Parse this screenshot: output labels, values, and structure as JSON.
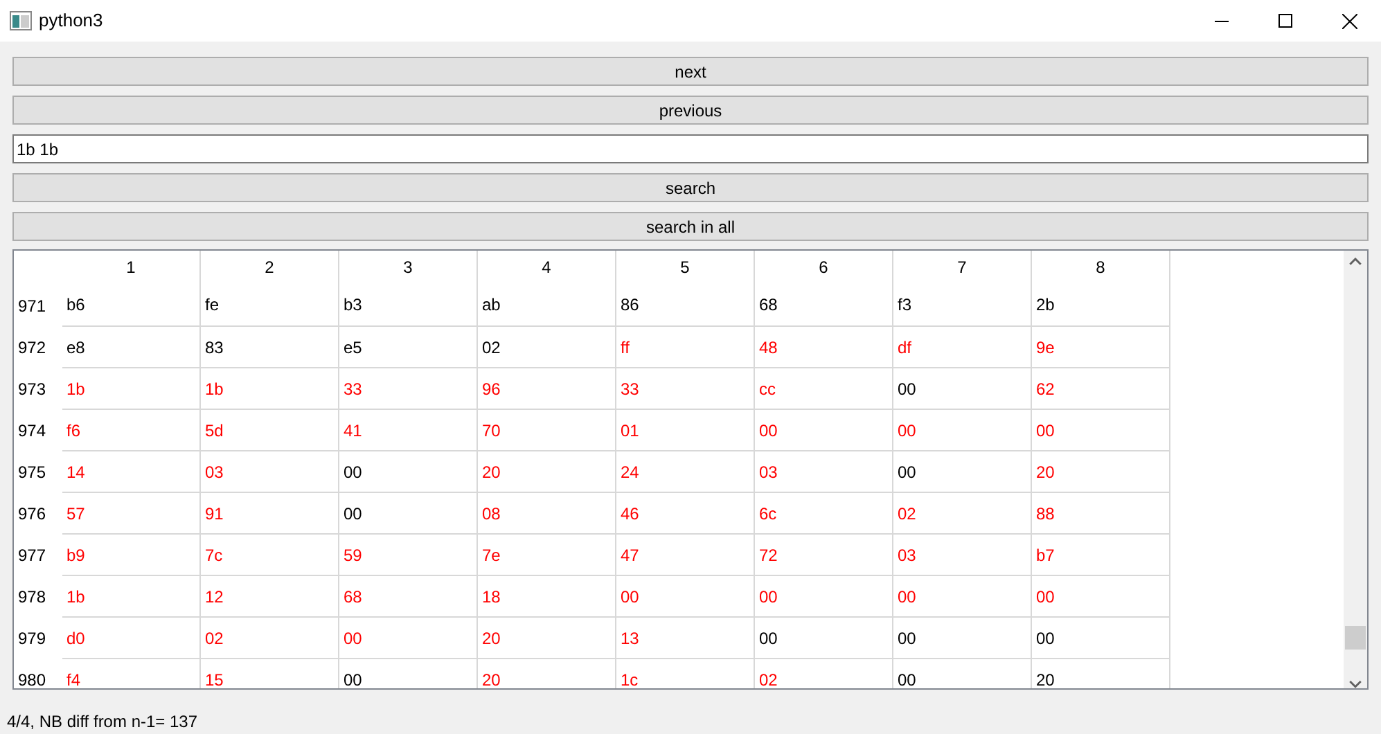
{
  "window": {
    "title": "python3"
  },
  "buttons": [
    {
      "label": "next"
    },
    {
      "label": "previous"
    }
  ],
  "search_field": {
    "value": "1b 1b"
  },
  "search_buttons": [
    {
      "label": "search"
    },
    {
      "label": "search in all"
    }
  ],
  "table": {
    "columns": [
      "1",
      "2",
      "3",
      "4",
      "5",
      "6",
      "7",
      "8"
    ],
    "rows": [
      {
        "header": "971",
        "cells": [
          {
            "text": "b6",
            "color": "#000000"
          },
          {
            "text": "fe",
            "color": "#000000"
          },
          {
            "text": "b3",
            "color": "#000000"
          },
          {
            "text": "ab",
            "color": "#000000"
          },
          {
            "text": "86",
            "color": "#000000"
          },
          {
            "text": "68",
            "color": "#000000"
          },
          {
            "text": "f3",
            "color": "#000000"
          },
          {
            "text": "2b",
            "color": "#000000"
          }
        ]
      },
      {
        "header": "972",
        "cells": [
          {
            "text": "e8",
            "color": "#000000"
          },
          {
            "text": "83",
            "color": "#000000"
          },
          {
            "text": "e5",
            "color": "#000000"
          },
          {
            "text": "02",
            "color": "#000000"
          },
          {
            "text": "ff",
            "color": "#ff0000"
          },
          {
            "text": "48",
            "color": "#ff0000"
          },
          {
            "text": "df",
            "color": "#ff0000"
          },
          {
            "text": "9e",
            "color": "#ff0000"
          }
        ]
      },
      {
        "header": "973",
        "cells": [
          {
            "text": "1b",
            "color": "#ff0000"
          },
          {
            "text": "1b",
            "color": "#ff0000"
          },
          {
            "text": "33",
            "color": "#ff0000"
          },
          {
            "text": "96",
            "color": "#ff0000"
          },
          {
            "text": "33",
            "color": "#ff0000"
          },
          {
            "text": "cc",
            "color": "#ff0000"
          },
          {
            "text": "00",
            "color": "#000000"
          },
          {
            "text": "62",
            "color": "#ff0000"
          }
        ]
      },
      {
        "header": "974",
        "cells": [
          {
            "text": "f6",
            "color": "#ff0000"
          },
          {
            "text": "5d",
            "color": "#ff0000"
          },
          {
            "text": "41",
            "color": "#ff0000"
          },
          {
            "text": "70",
            "color": "#ff0000"
          },
          {
            "text": "01",
            "color": "#ff0000"
          },
          {
            "text": "00",
            "color": "#ff0000"
          },
          {
            "text": "00",
            "color": "#ff0000"
          },
          {
            "text": "00",
            "color": "#ff0000"
          }
        ]
      },
      {
        "header": "975",
        "cells": [
          {
            "text": "14",
            "color": "#ff0000"
          },
          {
            "text": "03",
            "color": "#ff0000"
          },
          {
            "text": "00",
            "color": "#000000"
          },
          {
            "text": "20",
            "color": "#ff0000"
          },
          {
            "text": "24",
            "color": "#ff0000"
          },
          {
            "text": "03",
            "color": "#ff0000"
          },
          {
            "text": "00",
            "color": "#000000"
          },
          {
            "text": "20",
            "color": "#ff0000"
          }
        ]
      },
      {
        "header": "976",
        "cells": [
          {
            "text": "57",
            "color": "#ff0000"
          },
          {
            "text": "91",
            "color": "#ff0000"
          },
          {
            "text": "00",
            "color": "#000000"
          },
          {
            "text": "08",
            "color": "#ff0000"
          },
          {
            "text": "46",
            "color": "#ff0000"
          },
          {
            "text": "6c",
            "color": "#ff0000"
          },
          {
            "text": "02",
            "color": "#ff0000"
          },
          {
            "text": "88",
            "color": "#ff0000"
          }
        ]
      },
      {
        "header": "977",
        "cells": [
          {
            "text": "b9",
            "color": "#ff0000"
          },
          {
            "text": "7c",
            "color": "#ff0000"
          },
          {
            "text": "59",
            "color": "#ff0000"
          },
          {
            "text": "7e",
            "color": "#ff0000"
          },
          {
            "text": "47",
            "color": "#ff0000"
          },
          {
            "text": "72",
            "color": "#ff0000"
          },
          {
            "text": "03",
            "color": "#ff0000"
          },
          {
            "text": "b7",
            "color": "#ff0000"
          }
        ]
      },
      {
        "header": "978",
        "cells": [
          {
            "text": "1b",
            "color": "#ff0000"
          },
          {
            "text": "12",
            "color": "#ff0000"
          },
          {
            "text": "68",
            "color": "#ff0000"
          },
          {
            "text": "18",
            "color": "#ff0000"
          },
          {
            "text": "00",
            "color": "#ff0000"
          },
          {
            "text": "00",
            "color": "#ff0000"
          },
          {
            "text": "00",
            "color": "#ff0000"
          },
          {
            "text": "00",
            "color": "#ff0000"
          }
        ]
      },
      {
        "header": "979",
        "cells": [
          {
            "text": "d0",
            "color": "#ff0000"
          },
          {
            "text": "02",
            "color": "#ff0000"
          },
          {
            "text": "00",
            "color": "#ff0000"
          },
          {
            "text": "20",
            "color": "#ff0000"
          },
          {
            "text": "13",
            "color": "#ff0000"
          },
          {
            "text": "00",
            "color": "#000000"
          },
          {
            "text": "00",
            "color": "#000000"
          },
          {
            "text": "00",
            "color": "#000000"
          }
        ]
      },
      {
        "header": "980",
        "cells": [
          {
            "text": "f4",
            "color": "#ff0000"
          },
          {
            "text": "15",
            "color": "#ff0000"
          },
          {
            "text": "00",
            "color": "#000000"
          },
          {
            "text": "20",
            "color": "#ff0000"
          },
          {
            "text": "1c",
            "color": "#ff0000"
          },
          {
            "text": "02",
            "color": "#ff0000"
          },
          {
            "text": "00",
            "color": "#000000"
          },
          {
            "text": "20",
            "color": "#000000"
          }
        ]
      }
    ]
  },
  "status_bar": "4/4, NB diff from n-1= 137"
}
